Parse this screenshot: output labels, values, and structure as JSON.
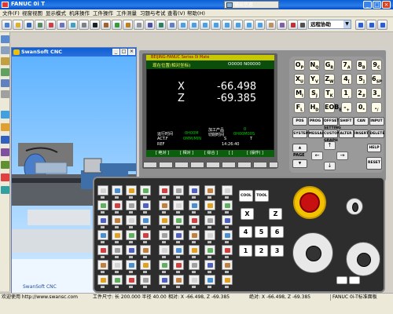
{
  "window": {
    "title": "FANUC 0i T",
    "output_window": "输出信息"
  },
  "menu": [
    "文件(F)",
    "视窗视图",
    "显示模式",
    "机床操作",
    "工件操作",
    "工件测量",
    "习题与考试",
    "查看(V)",
    "帮助(H)"
  ],
  "toolbar": {
    "program_select": "远程协助"
  },
  "sim": {
    "title": "SwanSoft CNC",
    "logo": "SwanSoft CNC"
  },
  "lcd": {
    "brand": "BEIJING-FANUC Series 0i Mate",
    "header_left": "现在位置(相对坐标)",
    "header_right": "O0000 N00000",
    "axes": [
      {
        "name": "X",
        "value": "-66.498"
      },
      {
        "name": "Z",
        "value": "-69.385"
      }
    ],
    "run_time_label": "运行时间",
    "run_time_value": "0H00M",
    "parts_label": "加工产品",
    "parts_value": "0",
    "cut_time_label": "切削时间",
    "cut_time_value": "0H00M00S",
    "act_f": "ACT.F",
    "act_f_value": "0MM/MIN",
    "s_label": "S",
    "t_label": "T",
    "mode": "REF",
    "clock": "14:26:40",
    "softkeys": [
      "[ 绝对 ]",
      "[ 相对 ]",
      "[ 综合 ]",
      "[ ]",
      "[ (操作) ]"
    ]
  },
  "keypad": {
    "letters": [
      [
        "O",
        "P"
      ],
      [
        "N",
        "Q"
      ],
      [
        "G",
        "R"
      ],
      [
        "7",
        "A"
      ],
      [
        "8",
        "B"
      ],
      [
        "9",
        "C"
      ],
      [
        "X",
        "U"
      ],
      [
        "Y",
        "V"
      ],
      [
        "Z",
        "W"
      ],
      [
        "4",
        "["
      ],
      [
        "5",
        "]"
      ],
      [
        "6",
        "SP"
      ],
      [
        "M",
        "I"
      ],
      [
        "S",
        "J"
      ],
      [
        "T",
        "K"
      ],
      [
        "1",
        ","
      ],
      [
        "2",
        "#"
      ],
      [
        "3",
        "="
      ],
      [
        "F",
        "L"
      ],
      [
        "H",
        "D"
      ],
      [
        "EOB",
        "E"
      ],
      [
        "-",
        "+"
      ],
      [
        "0",
        "*"
      ],
      [
        ".",
        "/"
      ]
    ],
    "func1": [
      "POS",
      "PROG",
      "OFFSET SETTING",
      "SHIFT",
      "CAN",
      "INPUT"
    ],
    "func2": [
      "SYSTEM",
      "MESSAGE",
      "CUSTOM GRAPH",
      "ALTER",
      "INSERT",
      "DELETE"
    ],
    "page_label": "PAGE",
    "reset_label": "RESET",
    "help_label": "HELP"
  },
  "panel": {
    "nums": [
      "COOL",
      "TOOL",
      "X",
      "Z",
      "4",
      "5",
      "6",
      "1",
      "2",
      "3"
    ]
  },
  "status": {
    "left": "欢迎使用 http://www.swansc.com",
    "mid": "工件尺寸: 长 200.000 半径 40.00",
    "rel": "相对: X -66.498, Z -69.385",
    "abs": "绝对: X -66.498, Z -69.385",
    "right": "FANUC 0i-T标准面板"
  }
}
